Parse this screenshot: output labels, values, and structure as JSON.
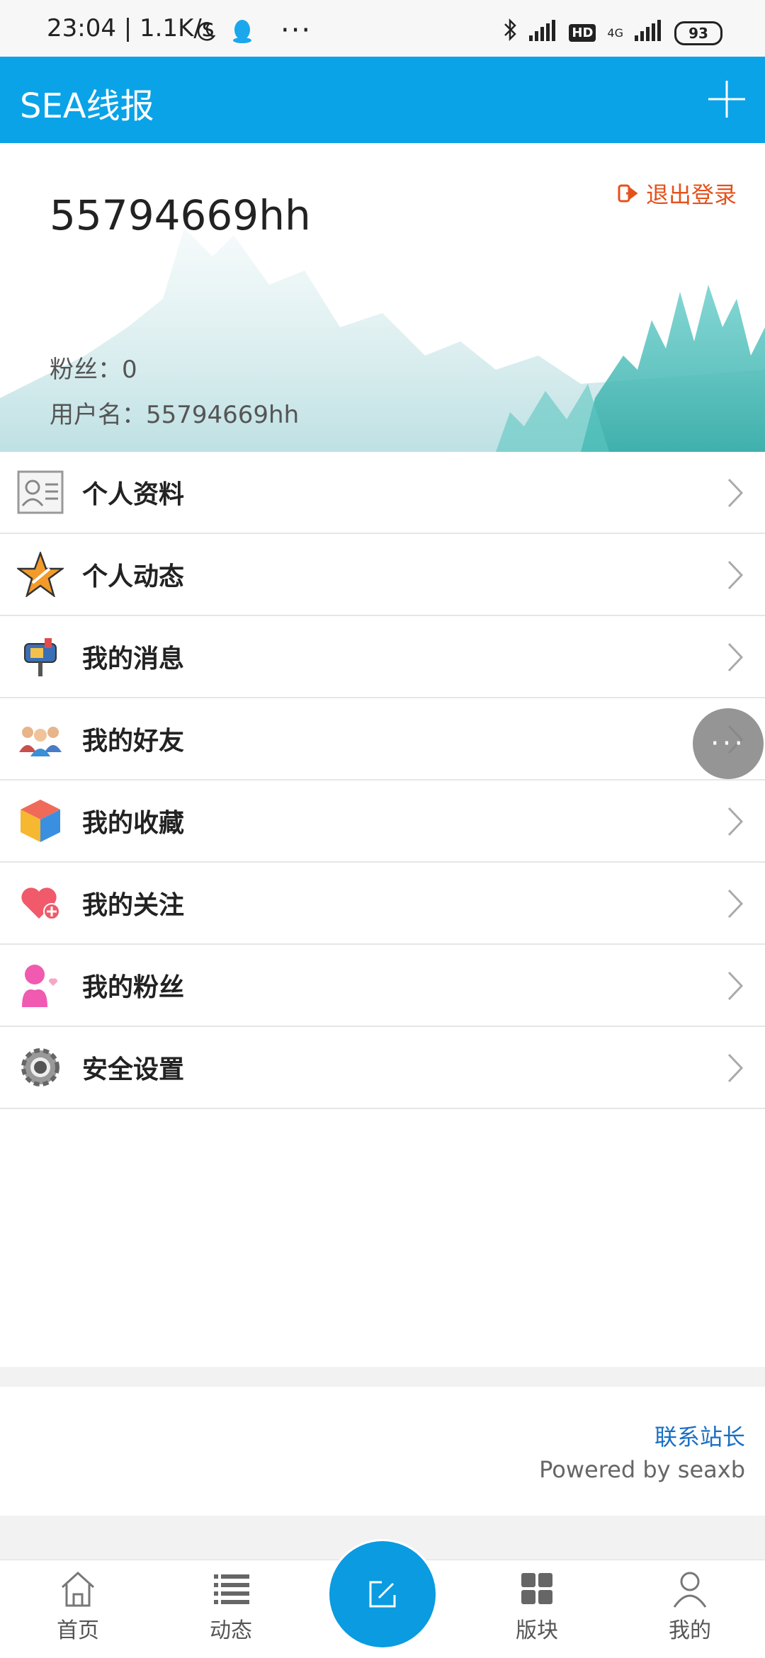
{
  "status_bar": {
    "time": "23:04 | 1.1K/s",
    "dots": "···",
    "network": "4G",
    "hd": "HD",
    "battery": "93"
  },
  "appbar": {
    "title": "SEA线报"
  },
  "profile": {
    "username": "55794669hh",
    "logout_label": "退出登录",
    "fans_line": "粉丝：0",
    "username_line": "用户名：55794669hh"
  },
  "menu": {
    "items": [
      {
        "label": "个人资料",
        "icon": "profile-card-icon"
      },
      {
        "label": "个人动态",
        "icon": "star-icon"
      },
      {
        "label": "我的消息",
        "icon": "mailbox-icon"
      },
      {
        "label": "我的好友",
        "icon": "friends-icon"
      },
      {
        "label": "我的收藏",
        "icon": "cube-icon"
      },
      {
        "label": "我的关注",
        "icon": "heart-plus-icon"
      },
      {
        "label": "我的粉丝",
        "icon": "fan-person-icon"
      },
      {
        "label": "安全设置",
        "icon": "gear-icon"
      }
    ]
  },
  "floating": {
    "label": "···"
  },
  "footer": {
    "contact": "联系站长",
    "powered": "Powered by seaxb"
  },
  "bottom_nav": {
    "items": [
      {
        "label": "首页",
        "icon": "home-icon"
      },
      {
        "label": "动态",
        "icon": "list-icon"
      },
      {
        "label": "",
        "icon": "compose-icon"
      },
      {
        "label": "版块",
        "icon": "grid-icon"
      },
      {
        "label": "我的",
        "icon": "user-icon"
      }
    ]
  },
  "colors": {
    "primary": "#0aa3e8",
    "logout": "#e4521c",
    "link": "#1a6fc4"
  }
}
